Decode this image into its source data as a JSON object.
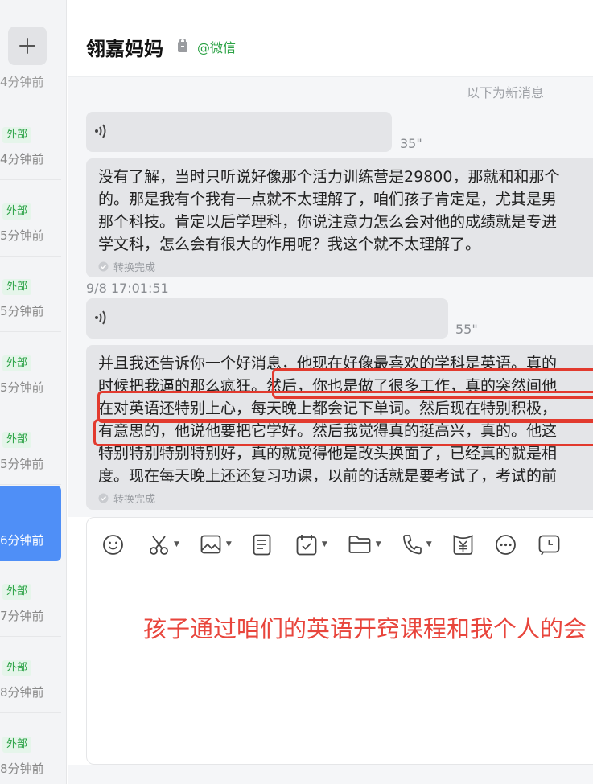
{
  "sidebar": {
    "add_label": "+",
    "top_time": "4分钟前",
    "items": [
      {
        "badge": "外部",
        "time": "4分钟前",
        "active": false
      },
      {
        "badge": "外部",
        "time": "5分钟前",
        "active": false
      },
      {
        "badge": "外部",
        "time": "5分钟前",
        "active": false
      },
      {
        "badge": "外部",
        "time": "5分钟前",
        "active": false
      },
      {
        "badge": "外部",
        "time": "5分钟前",
        "active": false
      },
      {
        "badge": "",
        "time": "6分钟前",
        "active": true
      },
      {
        "badge": "外部",
        "time": "7分钟前",
        "active": false
      },
      {
        "badge": "外部",
        "time": "8分钟前",
        "active": false
      },
      {
        "badge": "外部",
        "time": "8分钟前",
        "active": false
      }
    ]
  },
  "header": {
    "title": "翎嘉妈妈",
    "source": "@微信"
  },
  "messages": {
    "divider": "以下为新消息",
    "voice1_duration": "35\"",
    "msg1_lines": [
      "没有了解，当时只听说好像那个活力训练营是29800，那就和和那个",
      "的。那是我有个我有一点就不太理解了，咱们孩子肯定是，尤其是男",
      "那个科技。肯定以后学理科，你说注意力怎么会对他的成绩就是专进",
      "学文科，怎么会有很大的作用呢？我这个就不太理解了。"
    ],
    "msg1_status": "转换完成",
    "timestamp": "9/8 17:01:51",
    "voice2_duration": "55\"",
    "msg2_lines": [
      "并且我还告诉你一个好消息，他现在好像最喜欢的学科是英语。真的",
      "时候把我逼的那么疯狂。然后，你也是做了很多工作，真的突然间他",
      "在对英语还特别上心，每天晚上都会记下单词。然后现在特别积极，",
      "有意思的，他说他要把它学好。然后我觉得真的挺高兴，真的。他这",
      "特别特别特别特别好，真的就觉得他是改头换面了，已经真的就是相",
      "度。现在每天晚上还还复习功课，以前的话就是要考试了，考试的前"
    ],
    "msg2_status": "转换完成"
  },
  "composer": {
    "toolbar_icons": [
      "smile-icon",
      "scissors-icon",
      "image-icon",
      "document-icon",
      "calendar-check-icon",
      "folder-icon",
      "phone-icon",
      "red-packet-icon",
      "more-icon",
      "clock-icon"
    ],
    "draft_text": "孩子通过咱们的英语开窍课程和我个人的会"
  },
  "colors": {
    "accent_blue": "#4f8ff7",
    "external_green": "#2ba245",
    "highlight_red": "#e23a2e",
    "draft_red": "#e8453c"
  }
}
